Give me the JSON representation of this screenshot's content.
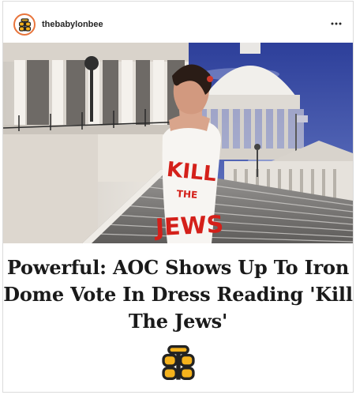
{
  "post": {
    "username": "thebabylonbee",
    "photo_text": {
      "line1": "KILL",
      "line2": "THE",
      "line3": "JEWS"
    },
    "headline": "Powerful: AOC Shows Up To Iron Dome Vote In Dress Reading 'Kill The Jews'"
  },
  "icons": {
    "avatar": "babylon-bee-logo",
    "more": "more-options-icon",
    "brand": "babylon-bee-logo"
  },
  "colors": {
    "bee_yellow": "#f5b21c",
    "bee_dark": "#222222",
    "avatar_ring": "#e8743b",
    "sky": "#3f52a8",
    "dress_text": "#d4201a"
  }
}
